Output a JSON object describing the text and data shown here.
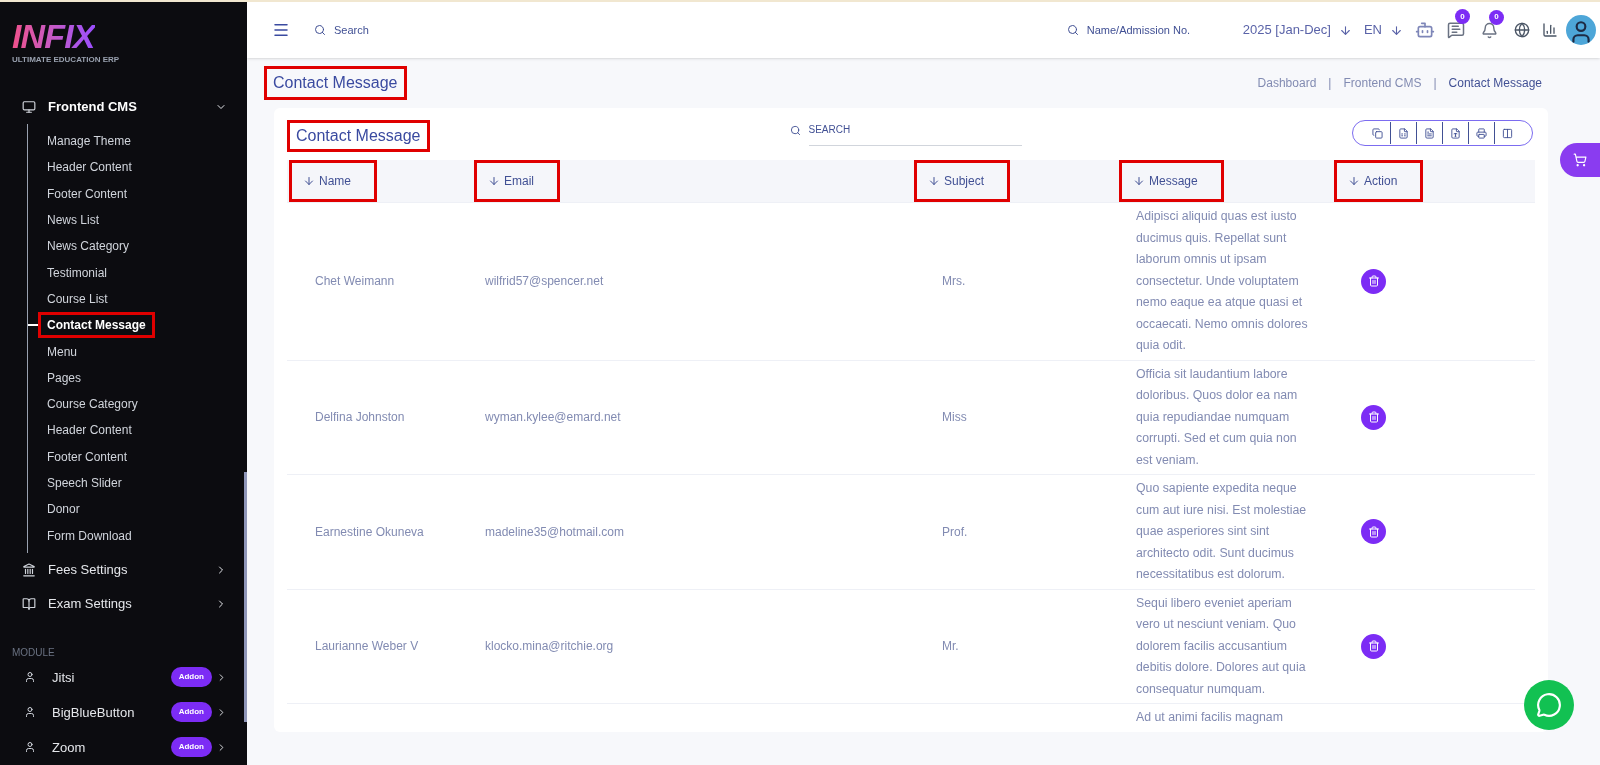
{
  "logo": {
    "text": "INFIX",
    "tagline": "ULTIMATE EDUCATION ERP"
  },
  "sidebar": {
    "groups": [
      {
        "kind": "cms",
        "label": "Frontend CMS",
        "expanded": true,
        "children": [
          {
            "label": "Manage Theme",
            "selected": false,
            "annotated": false
          },
          {
            "label": "Header Content",
            "selected": false,
            "annotated": false
          },
          {
            "label": "Footer Content",
            "selected": false,
            "annotated": false
          },
          {
            "label": "News List",
            "selected": false,
            "annotated": false
          },
          {
            "label": "News Category",
            "selected": false,
            "annotated": false
          },
          {
            "label": "Testimonial",
            "selected": false,
            "annotated": false
          },
          {
            "label": "Course List",
            "selected": false,
            "annotated": false
          },
          {
            "label": "Contact Message",
            "selected": true,
            "annotated": true
          },
          {
            "label": "Menu",
            "selected": false,
            "annotated": false
          },
          {
            "label": "Pages",
            "selected": false,
            "annotated": false
          },
          {
            "label": "Course Category",
            "selected": false,
            "annotated": false
          },
          {
            "label": "Header Content",
            "selected": false,
            "annotated": false
          },
          {
            "label": "Footer Content",
            "selected": false,
            "annotated": false
          },
          {
            "label": "Speech Slider",
            "selected": false,
            "annotated": false
          },
          {
            "label": "Donor",
            "selected": false,
            "annotated": false
          },
          {
            "label": "Form Download",
            "selected": false,
            "annotated": false
          }
        ]
      },
      {
        "kind": "fees",
        "label": "Fees Settings",
        "expanded": false
      },
      {
        "kind": "exam",
        "label": "Exam Settings",
        "expanded": false
      }
    ],
    "section_label": "MODULE",
    "modules": [
      {
        "label": "Jitsi",
        "badge": "Addon"
      },
      {
        "label": "BigBlueButton",
        "badge": "Addon"
      },
      {
        "label": "Zoom",
        "badge": "Addon"
      }
    ]
  },
  "topbar": {
    "search_placeholder": "Search",
    "student_search_placeholder": "Name/Admission No.",
    "year": "2025 [Jan-Dec]",
    "language": "EN",
    "chat_count": "0",
    "notification_count": "0"
  },
  "page_title": {
    "text": "Contact Message",
    "annotated": true
  },
  "breadcrumb": {
    "separator": "|",
    "items": [
      "Dashboard",
      "Frontend CMS",
      "Contact Message"
    ]
  },
  "card": {
    "title": "Contact Message",
    "annotated": true,
    "search_placeholder": "SEARCH",
    "columns": [
      {
        "label": "Name",
        "annotated": true
      },
      {
        "label": "Email",
        "annotated": true
      },
      {
        "label": "Subject",
        "annotated": true
      },
      {
        "label": "Message",
        "annotated": true
      },
      {
        "label": "Action",
        "annotated": true
      }
    ],
    "rows": [
      {
        "name": "Chet Weimann",
        "email": "wilfrid57@spencer.net",
        "subject": "Mrs.",
        "message": "Adipisci aliquid quas est iusto ducimus quis. Repellat sunt laborum omnis ut ipsam consectetur. Unde voluptatem nemo eaque ea atque quasi et occaecati. Nemo omnis dolores quia odit."
      },
      {
        "name": "Delfina Johnston",
        "email": "wyman.kylee@emard.net",
        "subject": "Miss",
        "message": "Officia sit laudantium labore doloribus. Quos dolor ea nam quia repudiandae numquam corrupti. Sed et cum quia non est veniam."
      },
      {
        "name": "Earnestine Okuneva",
        "email": "madeline35@hotmail.com",
        "subject": "Prof.",
        "message": "Quo sapiente expedita neque cum aut iure nisi. Est molestiae quae asperiores sint sint architecto odit. Sunt ducimus necessitatibus est dolorum."
      },
      {
        "name": "Laurianne Weber V",
        "email": "klocko.mina@ritchie.org",
        "subject": "Mr.",
        "message": "Sequi libero eveniet aperiam vero ut nesciunt veniam. Quo dolorem facilis accusantium debitis dolore. Dolores aut quia consequatur numquam."
      },
      {
        "message": "Ad ut animi facilis magnam"
      }
    ]
  }
}
